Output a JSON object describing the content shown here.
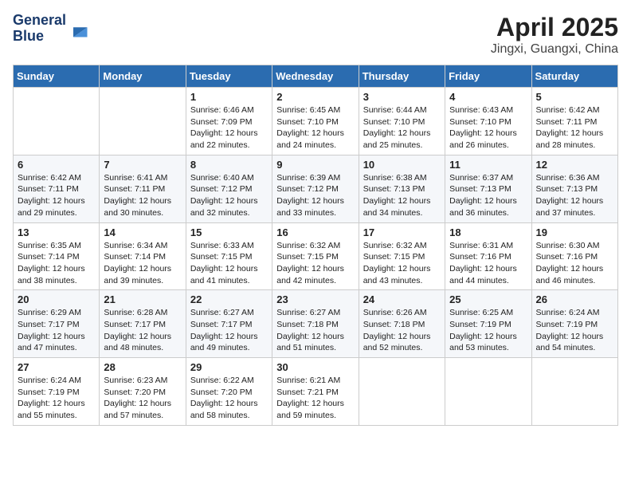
{
  "header": {
    "logo_line1": "General",
    "logo_line2": "Blue",
    "month": "April 2025",
    "location": "Jingxi, Guangxi, China"
  },
  "weekdays": [
    "Sunday",
    "Monday",
    "Tuesday",
    "Wednesday",
    "Thursday",
    "Friday",
    "Saturday"
  ],
  "weeks": [
    [
      null,
      null,
      {
        "day": "1",
        "sunrise": "6:46 AM",
        "sunset": "7:09 PM",
        "daylight": "12 hours and 22 minutes."
      },
      {
        "day": "2",
        "sunrise": "6:45 AM",
        "sunset": "7:10 PM",
        "daylight": "12 hours and 24 minutes."
      },
      {
        "day": "3",
        "sunrise": "6:44 AM",
        "sunset": "7:10 PM",
        "daylight": "12 hours and 25 minutes."
      },
      {
        "day": "4",
        "sunrise": "6:43 AM",
        "sunset": "7:10 PM",
        "daylight": "12 hours and 26 minutes."
      },
      {
        "day": "5",
        "sunrise": "6:42 AM",
        "sunset": "7:11 PM",
        "daylight": "12 hours and 28 minutes."
      }
    ],
    [
      {
        "day": "6",
        "sunrise": "6:42 AM",
        "sunset": "7:11 PM",
        "daylight": "12 hours and 29 minutes."
      },
      {
        "day": "7",
        "sunrise": "6:41 AM",
        "sunset": "7:11 PM",
        "daylight": "12 hours and 30 minutes."
      },
      {
        "day": "8",
        "sunrise": "6:40 AM",
        "sunset": "7:12 PM",
        "daylight": "12 hours and 32 minutes."
      },
      {
        "day": "9",
        "sunrise": "6:39 AM",
        "sunset": "7:12 PM",
        "daylight": "12 hours and 33 minutes."
      },
      {
        "day": "10",
        "sunrise": "6:38 AM",
        "sunset": "7:13 PM",
        "daylight": "12 hours and 34 minutes."
      },
      {
        "day": "11",
        "sunrise": "6:37 AM",
        "sunset": "7:13 PM",
        "daylight": "12 hours and 36 minutes."
      },
      {
        "day": "12",
        "sunrise": "6:36 AM",
        "sunset": "7:13 PM",
        "daylight": "12 hours and 37 minutes."
      }
    ],
    [
      {
        "day": "13",
        "sunrise": "6:35 AM",
        "sunset": "7:14 PM",
        "daylight": "12 hours and 38 minutes."
      },
      {
        "day": "14",
        "sunrise": "6:34 AM",
        "sunset": "7:14 PM",
        "daylight": "12 hours and 39 minutes."
      },
      {
        "day": "15",
        "sunrise": "6:33 AM",
        "sunset": "7:15 PM",
        "daylight": "12 hours and 41 minutes."
      },
      {
        "day": "16",
        "sunrise": "6:32 AM",
        "sunset": "7:15 PM",
        "daylight": "12 hours and 42 minutes."
      },
      {
        "day": "17",
        "sunrise": "6:32 AM",
        "sunset": "7:15 PM",
        "daylight": "12 hours and 43 minutes."
      },
      {
        "day": "18",
        "sunrise": "6:31 AM",
        "sunset": "7:16 PM",
        "daylight": "12 hours and 44 minutes."
      },
      {
        "day": "19",
        "sunrise": "6:30 AM",
        "sunset": "7:16 PM",
        "daylight": "12 hours and 46 minutes."
      }
    ],
    [
      {
        "day": "20",
        "sunrise": "6:29 AM",
        "sunset": "7:17 PM",
        "daylight": "12 hours and 47 minutes."
      },
      {
        "day": "21",
        "sunrise": "6:28 AM",
        "sunset": "7:17 PM",
        "daylight": "12 hours and 48 minutes."
      },
      {
        "day": "22",
        "sunrise": "6:27 AM",
        "sunset": "7:17 PM",
        "daylight": "12 hours and 49 minutes."
      },
      {
        "day": "23",
        "sunrise": "6:27 AM",
        "sunset": "7:18 PM",
        "daylight": "12 hours and 51 minutes."
      },
      {
        "day": "24",
        "sunrise": "6:26 AM",
        "sunset": "7:18 PM",
        "daylight": "12 hours and 52 minutes."
      },
      {
        "day": "25",
        "sunrise": "6:25 AM",
        "sunset": "7:19 PM",
        "daylight": "12 hours and 53 minutes."
      },
      {
        "day": "26",
        "sunrise": "6:24 AM",
        "sunset": "7:19 PM",
        "daylight": "12 hours and 54 minutes."
      }
    ],
    [
      {
        "day": "27",
        "sunrise": "6:24 AM",
        "sunset": "7:19 PM",
        "daylight": "12 hours and 55 minutes."
      },
      {
        "day": "28",
        "sunrise": "6:23 AM",
        "sunset": "7:20 PM",
        "daylight": "12 hours and 57 minutes."
      },
      {
        "day": "29",
        "sunrise": "6:22 AM",
        "sunset": "7:20 PM",
        "daylight": "12 hours and 58 minutes."
      },
      {
        "day": "30",
        "sunrise": "6:21 AM",
        "sunset": "7:21 PM",
        "daylight": "12 hours and 59 minutes."
      },
      null,
      null,
      null
    ]
  ]
}
